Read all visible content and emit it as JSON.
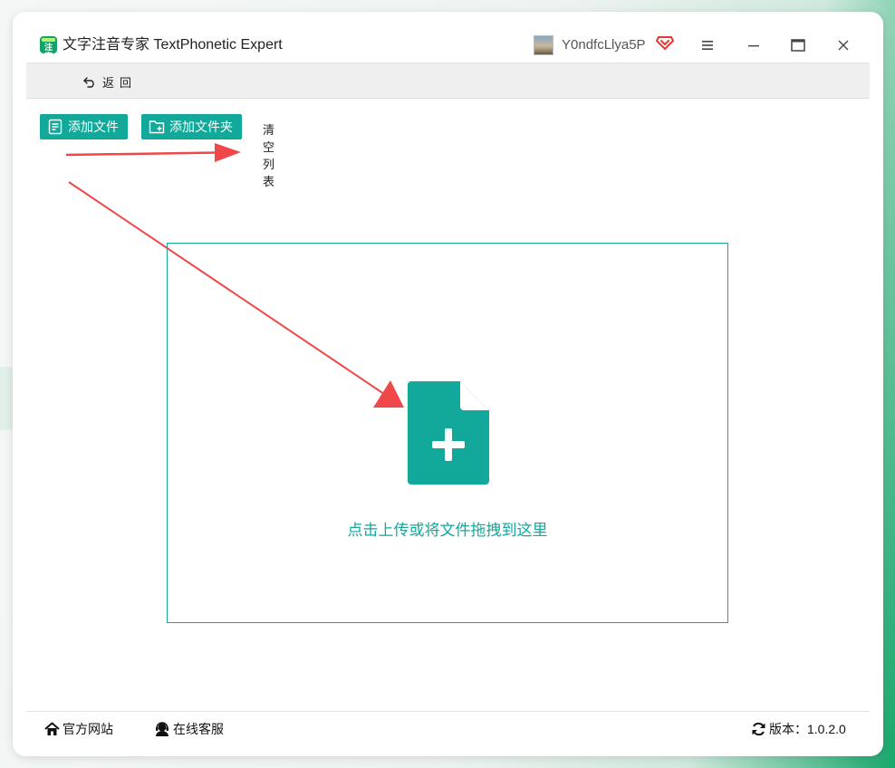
{
  "window": {
    "app_title": "文字注音专家 TextPhonetic Expert",
    "logo_text": "注字",
    "username": "Y0ndfcLlya5P"
  },
  "toolbar": {
    "back_label": "返回"
  },
  "actions": {
    "add_file_label": "添加文件",
    "add_folder_label": "添加文件夹",
    "clear_list_label": "清空列表"
  },
  "drop_zone": {
    "hint": "点击上传或将文件拖拽到这里"
  },
  "footer": {
    "official_site_label": "官方网站",
    "online_service_label": "在线客服",
    "version_label": "版本：1.0.2.0"
  },
  "colors": {
    "accent": "#12a89a",
    "annotation_arrow": "#f04848",
    "title_text": "#222222"
  },
  "icons": {
    "back": "undo-arrow-icon",
    "add_file": "file-list-icon",
    "add_folder": "folder-plus-icon",
    "drop": "file-plus-icon",
    "official_site": "home-icon",
    "online_service": "support-agent-icon",
    "version": "refresh-icon",
    "vip": "diamond-vip-icon"
  }
}
